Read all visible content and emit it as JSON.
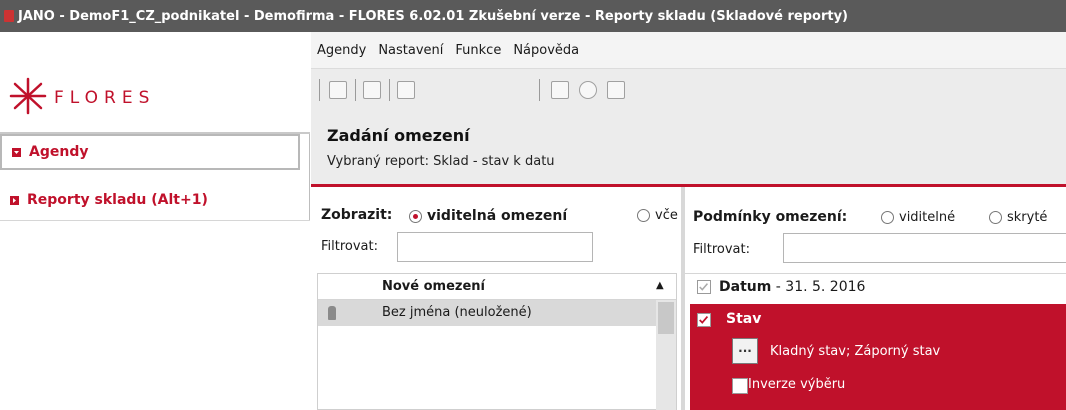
{
  "window": {
    "title": "JANO - DemoF1_CZ_podnikatel - Demofirma - FLORES 6.02.01 Zkušební verze - Reporty skladu  (Skladové reporty)"
  },
  "sidebar": {
    "logo_text": "FLORES",
    "items": [
      {
        "label": "Agendy",
        "active": true
      },
      {
        "label": "Reporty skladu (Alt+1)",
        "active": false
      }
    ]
  },
  "menu": {
    "items": [
      "Agendy",
      "Nastavení",
      "Funkce",
      "Nápověda"
    ]
  },
  "toolbar": {
    "icons": [
      "open-icon",
      "close-doc-icon",
      "list-icon",
      "info-icon",
      "help-icon",
      "question-icon"
    ]
  },
  "header": {
    "title": "Zadání omezení",
    "subtitle": "Vybraný report: Sklad - stav k datu"
  },
  "left_panel": {
    "show_label": "Zobrazit:",
    "option_visible": "viditelná omezení",
    "option_all": "vče",
    "filter_label": "Filtrovat:",
    "grid_header": "Nové omezení",
    "rows": [
      "Bez jména (neuložené)"
    ]
  },
  "right_panel": {
    "conditions_label": "Podmínky omezení:",
    "option_visible": "viditelné",
    "option_hidden": "skryté",
    "filter_label": "Filtrovat:",
    "datum_label": "Datum",
    "datum_value": " - 31. 5. 2016",
    "stav_label": "Stav",
    "stav_dots": "...",
    "stav_value": "Kladný stav; Záporný stav",
    "inverse_label": "Inverze výběru"
  },
  "colors": {
    "accent": "#c0112b",
    "titlebar": "#5a5a5a"
  }
}
